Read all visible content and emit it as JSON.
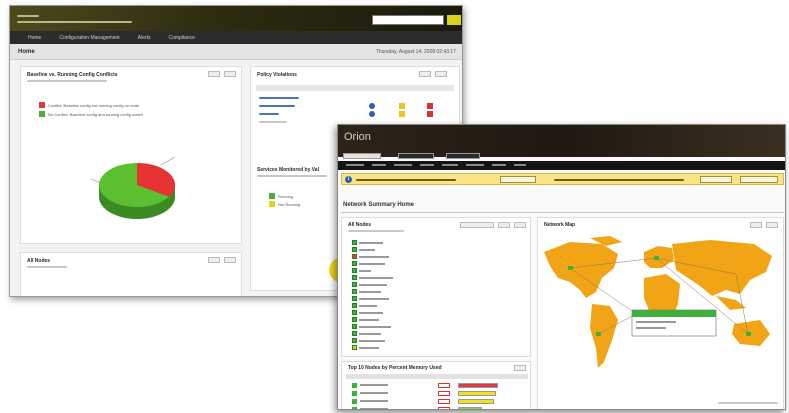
{
  "back_window": {
    "brand_lines": [
      "",
      ""
    ],
    "nav": [
      "Home",
      "Configuration Management",
      "Alerts",
      "Compliance"
    ],
    "page_title": "Home",
    "date": "Thursday, August 14, 2008 02:43:17",
    "panel_config": {
      "title": "Baseline vs. Running Config Conflicts",
      "legend": [
        {
          "label": "Conflict: Baseline config not running config on node",
          "color": "#e03a3a"
        },
        {
          "label": "No Conflict: Baseline config and running config match",
          "color": "#4caf3a"
        }
      ],
      "pie": {
        "conflict_fraction": 0.34,
        "colors": {
          "conflict": "#e53232",
          "ok": "#5bbf2f"
        }
      }
    },
    "panel_policy": {
      "title": "Policy Violations"
    },
    "panel_services": {
      "title": "Services Monitored by Val",
      "legend": [
        {
          "label": "Running",
          "color": "#4caf3a"
        },
        {
          "label": "Not Running",
          "color": "#e5d21c"
        }
      ]
    },
    "panel_bottom": {
      "title": "All Nodes"
    }
  },
  "front_window": {
    "brand": "Orion",
    "page_title": "Network Summary Home",
    "all_nodes": {
      "title": "All Nodes",
      "nodes": [
        {
          "status": "#3bb43b",
          "w": 24
        },
        {
          "status": "#3bb43b",
          "w": 16
        },
        {
          "status": "#e04040",
          "w": 30
        },
        {
          "status": "#3bb43b",
          "w": 26
        },
        {
          "status": "#3bb43b",
          "w": 12
        },
        {
          "status": "#3bb43b",
          "w": 34
        },
        {
          "status": "#3bb43b",
          "w": 28
        },
        {
          "status": "#3bb43b",
          "w": 22
        },
        {
          "status": "#3bb43b",
          "w": 30
        },
        {
          "status": "#3bb43b",
          "w": 18
        },
        {
          "status": "#3bb43b",
          "w": 24
        },
        {
          "status": "#3bb43b",
          "w": 20
        },
        {
          "status": "#3bb43b",
          "w": 32
        },
        {
          "status": "#3bb43b",
          "w": 22
        },
        {
          "status": "#3bb43b",
          "w": 26
        },
        {
          "status": "#e8d020",
          "w": 20
        }
      ]
    },
    "top_nodes": {
      "title": "Top 10 Nodes by Percent Memory Used",
      "rows": [
        {
          "status": "#3bb43b",
          "pct_color": "#e03030",
          "bar_color": "#e03a4a",
          "fill": 1.0
        },
        {
          "status": "#3bb43b",
          "pct_color": "#e03030",
          "bar_color": "#f0e020",
          "fill": 0.95
        },
        {
          "status": "#3bb43b",
          "pct_color": "#e03030",
          "bar_color": "#f0e020",
          "fill": 0.9
        },
        {
          "status": "#3bb43b",
          "pct_color": "#e03030",
          "bar_color": "#8bd34a",
          "fill": 0.6
        }
      ]
    },
    "network_map": {
      "title": "Network Map",
      "popup_color": "#3fae3a"
    },
    "colors": {
      "map_land": "#f0a416",
      "map_water": "#ffffff"
    }
  }
}
